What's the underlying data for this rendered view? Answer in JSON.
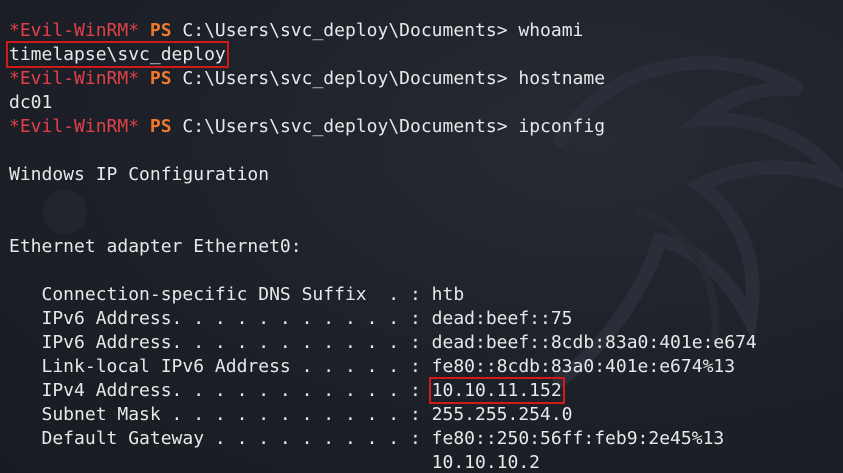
{
  "session": {
    "prompt_evil": "*Evil-WinRM*",
    "prompt_ps": "PS",
    "prompt_path": "C:\\Users\\svc_deploy\\Documents>"
  },
  "commands": [
    {
      "cmd": "whoami",
      "output": "timelapse\\svc_deploy"
    },
    {
      "cmd": "hostname",
      "output": "dc01"
    },
    {
      "cmd": "ipconfig"
    }
  ],
  "ipconfig": {
    "title": "Windows IP Configuration",
    "adapter": "Ethernet adapter Ethernet0:",
    "rows": [
      {
        "label": "   Connection-specific DNS Suffix  . : ",
        "value": "htb"
      },
      {
        "label": "   IPv6 Address. . . . . . . . . . . : ",
        "value": "dead:beef::75"
      },
      {
        "label": "   IPv6 Address. . . . . . . . . . . : ",
        "value": "dead:beef::8cdb:83a0:401e:e674"
      },
      {
        "label": "   Link-local IPv6 Address . . . . . : ",
        "value": "fe80::8cdb:83a0:401e:e674%13"
      },
      {
        "label": "   IPv4 Address. . . . . . . . . . . : ",
        "value": "10.10.11.152"
      },
      {
        "label": "   Subnet Mask . . . . . . . . . . . : ",
        "value": "255.255.254.0"
      },
      {
        "label": "   Default Gateway . . . . . . . . . : ",
        "value": "fe80::250:56ff:feb9:2e45%13"
      },
      {
        "label": "                                       ",
        "value": "10.10.10.2"
      }
    ]
  },
  "colors": {
    "background": "#1d2028",
    "prompt_evil": "#e0404a",
    "prompt_ps": "#f07a2a",
    "text": "#e8e8e8",
    "highlight_box": "#d11a1a"
  }
}
